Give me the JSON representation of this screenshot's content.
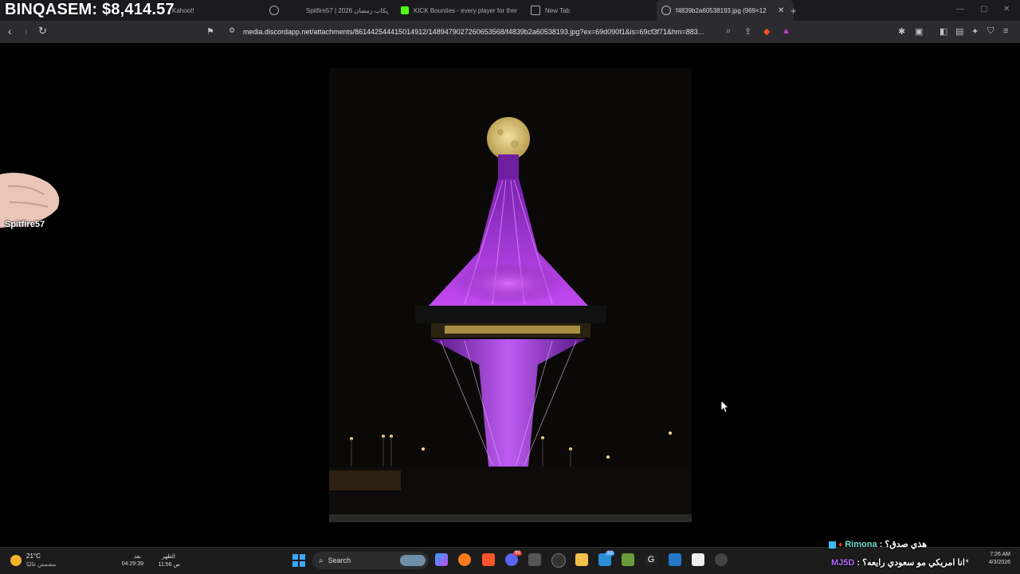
{
  "overlay": {
    "balance": "BINQASEM: $8,414.57"
  },
  "tabs": [
    {
      "label": "Kahoot!",
      "active": false
    },
    {
      "label": "Spitfire57 | ريكاب رمضان 2026",
      "active": false
    },
    {
      "label": "KICK Bounties - every player for them",
      "active": false
    },
    {
      "label": "New Tab",
      "active": false
    },
    {
      "label": "f4839b2a60538193.jpg (969×12",
      "active": true
    }
  ],
  "toolbar": {
    "url": "media.discordapp.net/attachments/861442544415014912/1489479027260653568/f4839b2a60538193.jpg?ex=69d090f1&is=69cf3f71&hm=883..."
  },
  "stream": {
    "streamer_name": "Spitfire57"
  },
  "taskbar": {
    "weather_temp": "21°C",
    "weather_desc": "مشمس غالبًا",
    "prayer_next_label": "بعد",
    "prayer_next_time": "04:29:39",
    "prayer_name": "الظهر",
    "prayer_time": "11:56 ص",
    "search_label": "Search",
    "time": "7:26 AM",
    "date": "4/3/2026",
    "badges": [
      "99",
      "22"
    ]
  },
  "chat": [
    {
      "user": "Rimona",
      "message": "هذي صدق؟"
    },
    {
      "user": "MJ5D",
      "message": "انا امريكي مو سعودي رايعه؟"
    }
  ],
  "colors": {
    "tower_purple": "#b23ee8",
    "moon": "#e8d48a",
    "rimona": "#6fe0c9",
    "mj5d": "#b46cff"
  }
}
